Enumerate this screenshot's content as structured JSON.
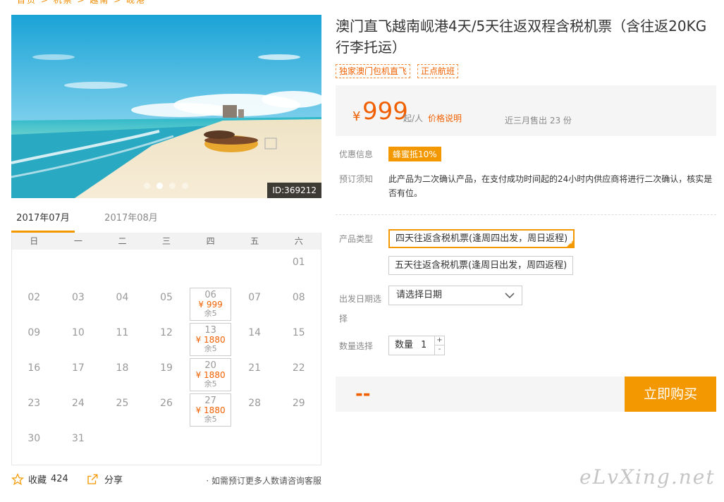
{
  "breadcrumb": "首页 > 机票 > 越南 > 岘港",
  "hero": {
    "id_badge": "ID:369212",
    "slide_count": 4,
    "active_slide": 1
  },
  "calendar": {
    "tabs": [
      {
        "label": "2017年07月",
        "active": true
      },
      {
        "label": "2017年08月",
        "active": false
      }
    ],
    "weekdays": [
      "日",
      "一",
      "二",
      "三",
      "四",
      "五",
      "六"
    ],
    "weeks": [
      [
        null,
        null,
        null,
        null,
        null,
        null,
        {
          "day": "01"
        }
      ],
      [
        {
          "day": "02"
        },
        {
          "day": "03"
        },
        {
          "day": "04"
        },
        {
          "day": "05"
        },
        {
          "day": "06",
          "price": "¥ 999",
          "stock": "余5"
        },
        {
          "day": "07"
        },
        {
          "day": "08"
        }
      ],
      [
        {
          "day": "09"
        },
        {
          "day": "10"
        },
        {
          "day": "11"
        },
        {
          "day": "12"
        },
        {
          "day": "13",
          "price": "¥ 1880",
          "stock": "余5"
        },
        {
          "day": "14"
        },
        {
          "day": "15"
        }
      ],
      [
        {
          "day": "16"
        },
        {
          "day": "17"
        },
        {
          "day": "18"
        },
        {
          "day": "19"
        },
        {
          "day": "20",
          "price": "¥ 1880",
          "stock": "余5"
        },
        {
          "day": "21"
        },
        {
          "day": "22"
        }
      ],
      [
        {
          "day": "23"
        },
        {
          "day": "24"
        },
        {
          "day": "25"
        },
        {
          "day": "26"
        },
        {
          "day": "27",
          "price": "¥ 1880",
          "stock": "余5"
        },
        {
          "day": "28"
        },
        {
          "day": "29"
        }
      ],
      [
        {
          "day": "30"
        },
        {
          "day": "31"
        },
        null,
        null,
        null,
        null,
        null
      ]
    ]
  },
  "actions": {
    "favorite_label": "收藏",
    "favorite_count": "424",
    "share_label": "分享",
    "consult_text": "· 如需预订更多人数请咨询客服"
  },
  "product": {
    "title": "澳门直飞越南岘港4天/5天往返双程含税机票（含往返20KG行李托运）",
    "tags": [
      "独家澳门包机直飞",
      "正点航班"
    ],
    "price": {
      "currency": "¥",
      "value": "999",
      "unit": "起/人",
      "explain": "价格说明",
      "sold": "近三月售出 23 份"
    },
    "promo_label": "优惠信息",
    "promo_badge": "蜂蜜抵10%",
    "notice_label": "预订须知",
    "notice_text": "此产品为二次确认产品，在支付成功时间起的24小时内供应商将进行二次确认，核实是否有位。",
    "type_label": "产品类型",
    "types": [
      {
        "label": "四天往返含税机票(逢周四出发，周日返程)",
        "selected": true
      },
      {
        "label": "五天往返含税机票(逢周日出发，周四返程)",
        "selected": false
      }
    ],
    "date_label": "出发日期选择",
    "date_placeholder": "请选择日期",
    "qty_label": "数量选择",
    "qty_field_label": "数量",
    "qty_value": "1",
    "qty_up": "+",
    "qty_down": "-",
    "total": "--",
    "buy_label": "立即购买"
  },
  "watermark": "eLvXing.net",
  "colors": {
    "accent": "#f39800",
    "price": "#f06000"
  }
}
